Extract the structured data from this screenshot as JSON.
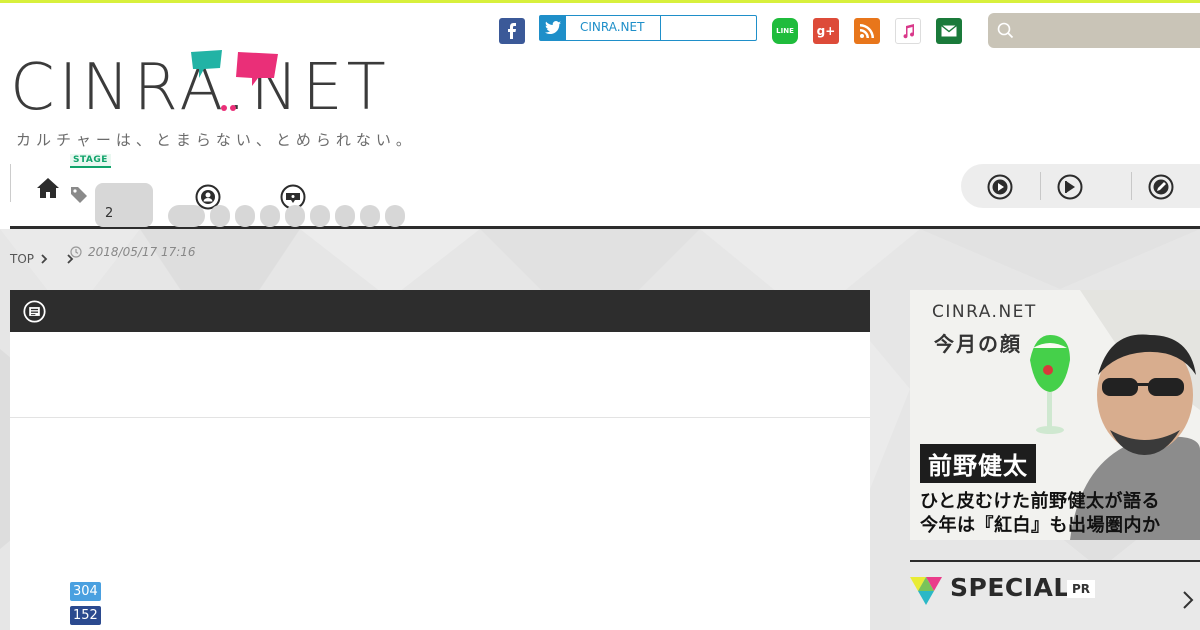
{
  "header": {
    "logo_text": "CINRA.NET",
    "tagline": "カルチャーは、とまらない、とめられない。",
    "twitter_label": "CINRA.NET",
    "search_placeholder": ""
  },
  "share_icons": [
    "facebook-icon",
    "twitter-icon",
    "line-icon",
    "google-plus-icon",
    "rss-icon",
    "itunes-icon",
    "mail-icon"
  ],
  "nav": {
    "left_icons": [
      "home-icon",
      "news-icon",
      "people-icon",
      "feature-icon"
    ],
    "right_icons": [
      "play-icon",
      "video-icon",
      "edit-icon"
    ]
  },
  "breadcrumb": {
    "top": "TOP"
  },
  "article": {
    "category": "STAGE",
    "tag_first": "2",
    "date": "2018/05/17 17:16",
    "count_1": "304",
    "count_2": "152"
  },
  "ad": {
    "logo": "CINRA.NET",
    "subtitle": "今月の顔",
    "name": "前野健太",
    "line1": "ひと皮むけた前野健太が語る",
    "line2": "今年は『紅白』も出場圏内か"
  },
  "special": {
    "label": "SPECIAL",
    "badge": "PR"
  },
  "colors": {
    "accent_bar": "#d8f03c",
    "twitter": "#1f8fc9",
    "facebook": "#3b5998",
    "line": "#1fbc3c",
    "google_plus": "#dd4b39",
    "rss": "#e8761b",
    "mail": "#1a7a3a",
    "stage_green": "#11a36b",
    "count_1": "#4aa0e0",
    "count_2": "#2b4a8f"
  }
}
